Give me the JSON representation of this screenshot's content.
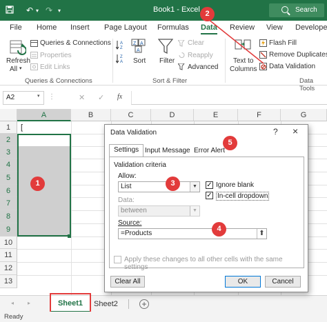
{
  "titlebar": {
    "title": "Book1 - Excel",
    "search_placeholder": "Search",
    "brand_color": "#217346"
  },
  "tabs": [
    "File",
    "Home",
    "Insert",
    "Page Layout",
    "Formulas",
    "Data",
    "Review",
    "View",
    "Developer"
  ],
  "active_tab": "Data",
  "ribbon": {
    "refresh_all": "Refresh",
    "refresh_all_line2": "All",
    "queries_connections": "Queries & Connections",
    "properties": "Properties",
    "edit_links": "Edit Links",
    "group_queries": "Queries & Connections",
    "sort": "Sort",
    "filter": "Filter",
    "clear": "Clear",
    "reapply": "Reapply",
    "advanced": "Advanced",
    "group_sort_filter": "Sort & Filter",
    "text_to_columns": "Text to",
    "text_to_columns_line2": "Columns",
    "flash_fill": "Flash Fill",
    "remove_duplicates": "Remove Duplicates",
    "data_validation": "Data Validation",
    "group_data_tools": "Data Tools"
  },
  "formula_bar": {
    "name_box": "A2",
    "fx": "fx"
  },
  "grid": {
    "columns": [
      "A",
      "B",
      "C",
      "D",
      "E",
      "F",
      "G"
    ],
    "rows": [
      "1",
      "2",
      "3",
      "4",
      "5",
      "6",
      "7",
      "8",
      "9",
      "10",
      "11",
      "12",
      "13"
    ]
  },
  "sheets": {
    "sheet1": "Sheet1",
    "sheet2": "Sheet2"
  },
  "status": "Ready",
  "dialog": {
    "title": "Data Validation",
    "help": "?",
    "close": "×",
    "tabs": [
      "Settings",
      "Input Message",
      "Error Alert"
    ],
    "active_tab": "Settings",
    "criteria_label": "Validation criteria",
    "allow_label": "Allow:",
    "allow_value": "List",
    "ignore_blank": "Ignore blank",
    "ignore_blank_checked": true,
    "in_cell_dropdown": "In-cell dropdown",
    "in_cell_dropdown_checked": true,
    "data_label": "Data:",
    "data_value": "between",
    "source_label": "Source:",
    "source_value": "=Products",
    "apply_all": "Apply these changes to all other cells with the same settings",
    "apply_all_checked": false,
    "clear_all": "Clear All",
    "ok": "OK",
    "cancel": "Cancel"
  },
  "callouts": [
    "1",
    "2",
    "3",
    "4",
    "5"
  ],
  "callout_color": "#e23b3b"
}
